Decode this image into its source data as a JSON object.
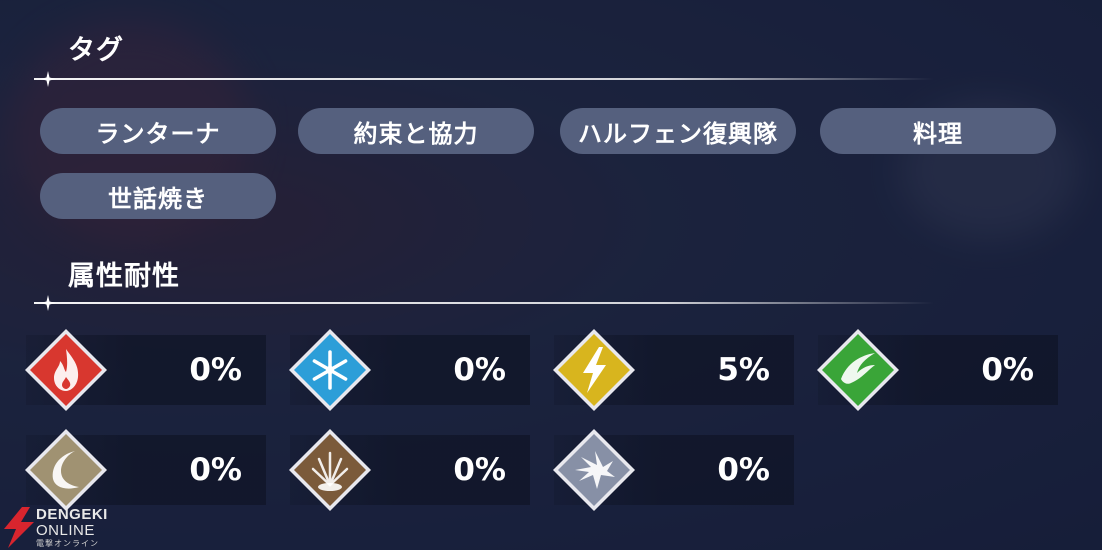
{
  "tags_section": {
    "title": "タグ",
    "tags": [
      "ランターナ",
      "約束と協力",
      "ハルフェン復興隊",
      "料理",
      "世話焼き"
    ]
  },
  "resist_section": {
    "title": "属性耐性",
    "items": [
      {
        "icon": "fire-icon",
        "color": "#d8372f",
        "value": "0%"
      },
      {
        "icon": "ice-icon",
        "color": "#2c9ed8",
        "value": "0%"
      },
      {
        "icon": "lightning-icon",
        "color": "#d8b51e",
        "value": "5%"
      },
      {
        "icon": "wind-icon",
        "color": "#3aa538",
        "value": "0%"
      },
      {
        "icon": "light-icon",
        "color": "#a09272",
        "value": "0%"
      },
      {
        "icon": "earth-icon",
        "color": "#7b5a3a",
        "value": "0%"
      },
      {
        "icon": "dark-icon",
        "color": "#8790a6",
        "value": "0%"
      }
    ]
  },
  "watermark": {
    "line1": "DENGEKI",
    "line2": "ONLINE",
    "line3": "電撃オンライン"
  }
}
